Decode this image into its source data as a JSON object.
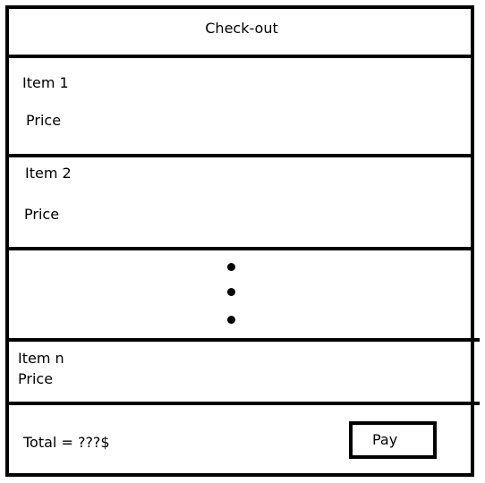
{
  "header": {
    "title": "Check-out"
  },
  "items": [
    {
      "name": "Item 1",
      "price": "Price"
    },
    {
      "name": "Item 2",
      "price": "Price"
    },
    {
      "name": "Item n",
      "price": "Price"
    }
  ],
  "ellipsis": {
    "icon": "vertical-ellipsis-icon"
  },
  "footer": {
    "total_label": "Total = ???$",
    "pay_label": "Pay"
  }
}
